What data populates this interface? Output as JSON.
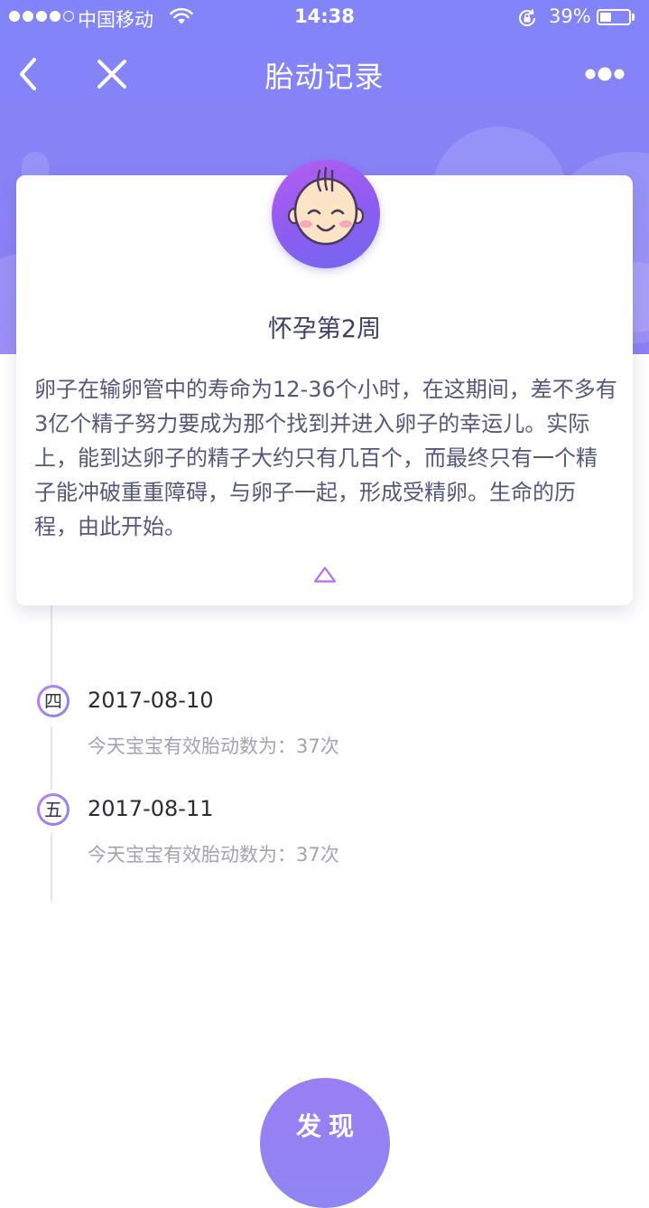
{
  "status_bar": {
    "carrier": "中国移动",
    "time": "14:38",
    "battery": "39%",
    "battery_level": 0.39,
    "signal_bars": 4,
    "signal_total": 5
  },
  "nav": {
    "title": "胎动记录",
    "back_icon": "chevron-left-icon",
    "close_icon": "close-icon",
    "more_icon": "more-dots-icon"
  },
  "card": {
    "week_title": "怀孕第2周",
    "description": "卵子在输卵管中的寿命为12-36个小时，在这期间，差不多有3亿个精子努力要成为那个找到并进入卵子的幸运儿。实际上，能到达卵子的精子大约只有几百个，而最终只有一个精子能冲破重重障碍，与卵子一起，形成受精卵。生命的历程，由此开始。",
    "avatar_icon": "baby-face-icon",
    "toggle_icon": "triangle-up-icon"
  },
  "timeline": [
    {
      "weekday": "四",
      "date": "2017-08-10",
      "text": "今天宝宝有效胎动数为：37次"
    },
    {
      "weekday": "五",
      "date": "2017-08-11",
      "text": "今天宝宝有效胎动数为：37次"
    }
  ],
  "discover_button": {
    "label": "发现"
  },
  "colors": {
    "header": "#8184f8",
    "accent": "#9a7ef3",
    "avatar": "#8c5cf0",
    "text_primary": "#3e4068",
    "text_secondary": "#a3a3b3"
  }
}
